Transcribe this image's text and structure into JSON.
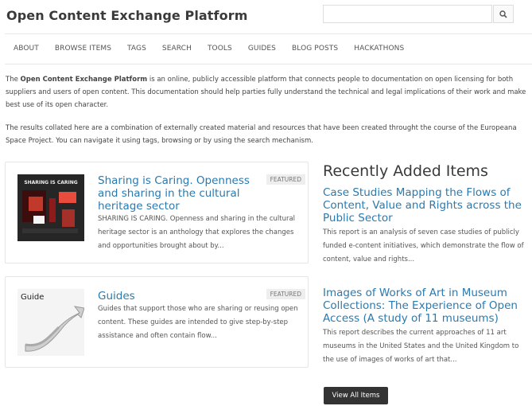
{
  "header": {
    "site_title": "Open Content Exchange Platform",
    "search_placeholder": "",
    "search_icon": "magnifier-icon"
  },
  "nav": [
    "About",
    "Browse Items",
    "Tags",
    "Search",
    "Tools",
    "Guides",
    "Blog Posts",
    "Hackathons"
  ],
  "intro": {
    "lead": "The ",
    "name": "Open Content Exchange Platform",
    "rest": " is an online, publicly accessible platform that connects people to documentation on open licensing for both suppliers and users of open content. This documentation should help parties fully understand the technical and legal implications of their work and make best use of its open character.",
    "para2": "The results collated here are a combination of externally created material and resources that have been created throught the course of the Europeana Space Project. You can navigate it using tags, browsing or by using the search mechanism."
  },
  "featured": [
    {
      "title": "Sharing is Caring. Openness and sharing in the cultural heritage sector",
      "badge": "Featured",
      "thumb_caption": "SHARING IS CARING",
      "description": "SHARING IS CARING. Openness and sharing in the cultural heritage sector is an anthology that explores the changes and opportunities brought about by..."
    },
    {
      "title": "Guides",
      "badge": "Featured",
      "thumb_caption": "Guide",
      "description": "Guides that support those who are sharing or reusing open content. These guides are intended to give step-by-step assistance and often contain flow..."
    }
  ],
  "recent": {
    "heading": "Recently Added Items",
    "items": [
      {
        "title": "Case Studies Mapping the Flows of Content, Value and Rights across the Public Sector",
        "description": "This report is an analysis of seven case studies of publicly funded e-content initiatives, which demonstrate the flow of content, value and rights..."
      },
      {
        "title": "Images of Works of Art in Museum Collections: The Experience of Open Access (A study of 11 museums)",
        "description": "This report describes the current approaches of 11 art museums in the United States and the United Kingdom to the use of images of works of art that..."
      }
    ],
    "view_all_label": "View All Items"
  },
  "colors": {
    "link": "#2a7ab0",
    "button_bg": "#333333",
    "badge_bg": "#eeeeee"
  }
}
